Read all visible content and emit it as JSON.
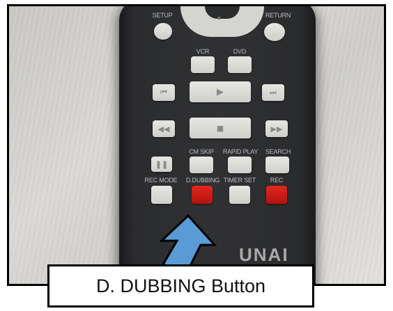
{
  "remote": {
    "top_labels": {
      "setup": "SETUP",
      "return": "RETURN"
    },
    "source_labels": {
      "vcr": "VCR",
      "dvd": "DVD"
    },
    "row_labels": {
      "cm_skip": "CM SKIP",
      "rapid_play": "RAPID PLAY",
      "search": "SEARCH"
    },
    "bottom_labels": {
      "rec_mode": "REC MODE",
      "d_dubbing": "D.DUBBING",
      "timer_set": "TIMER SET",
      "rec": "REC"
    },
    "brand_text": "UNAI"
  },
  "annotation": {
    "caption": "D. DUBBING Button",
    "arrow_color": "#5b9bd5",
    "arrow_outline": "#000000"
  },
  "colors": {
    "remote_body": "#2e2f31",
    "button_gray": "#d9d9d6",
    "button_red": "#d11a14",
    "background": "#d6d5d2"
  }
}
